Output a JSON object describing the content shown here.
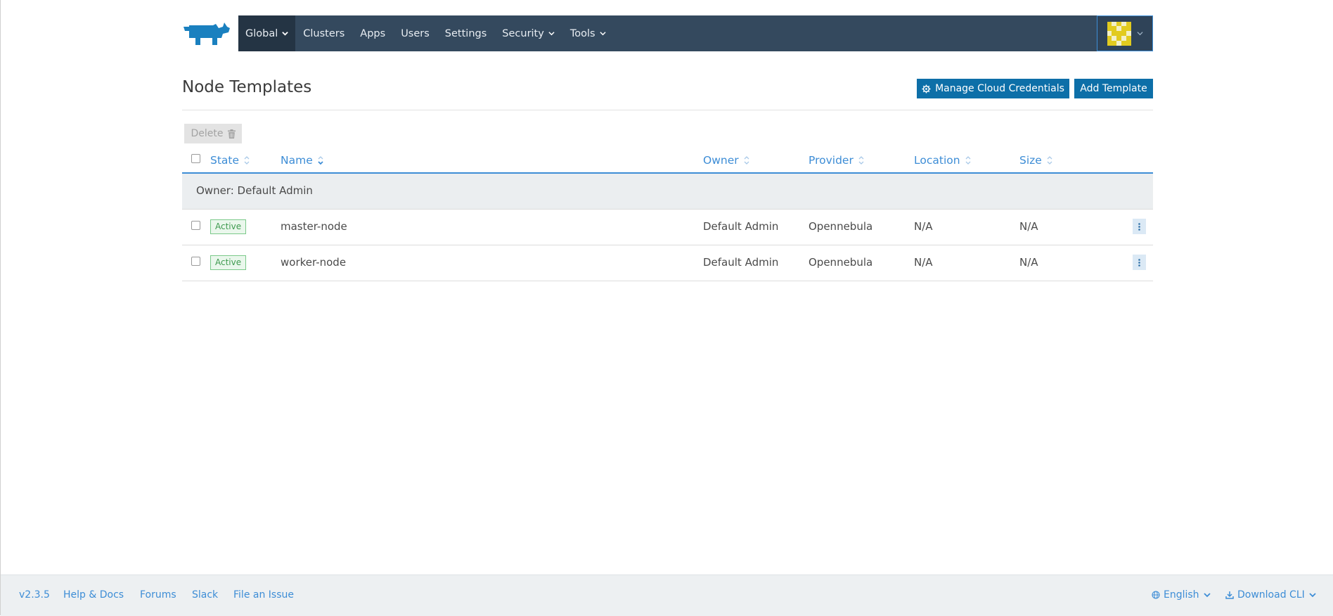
{
  "nav": {
    "items": [
      {
        "label": "Global",
        "has_dropdown": true,
        "active": true
      },
      {
        "label": "Clusters",
        "has_dropdown": false
      },
      {
        "label": "Apps",
        "has_dropdown": false
      },
      {
        "label": "Users",
        "has_dropdown": false
      },
      {
        "label": "Settings",
        "has_dropdown": false
      },
      {
        "label": "Security",
        "has_dropdown": true
      },
      {
        "label": "Tools",
        "has_dropdown": true
      }
    ],
    "logo_icon": "rancher-cow-logo",
    "avatar_icon": "user-identicon"
  },
  "page": {
    "title": "Node Templates",
    "manage_credentials_label": "Manage Cloud Credentials",
    "add_template_label": "Add Template",
    "delete_label": "Delete"
  },
  "table": {
    "columns": [
      "State",
      "Name",
      "Owner",
      "Provider",
      "Location",
      "Size"
    ],
    "group_label": "Owner: Default Admin",
    "rows": [
      {
        "state": "Active",
        "name": "master-node",
        "owner": "Default Admin",
        "provider": "Opennebula",
        "location": "N/A",
        "size": "N/A"
      },
      {
        "state": "Active",
        "name": "worker-node",
        "owner": "Default Admin",
        "provider": "Opennebula",
        "location": "N/A",
        "size": "N/A"
      }
    ]
  },
  "footer": {
    "version": "v2.3.5",
    "help": "Help & Docs",
    "forums": "Forums",
    "slack": "Slack",
    "issue": "File an Issue",
    "language": "English",
    "download": "Download CLI"
  },
  "colors": {
    "nav_bg": "#34495e",
    "accent": "#3d8dd6",
    "button": "#0d6fa8",
    "active_badge": "#3e9a4f"
  }
}
